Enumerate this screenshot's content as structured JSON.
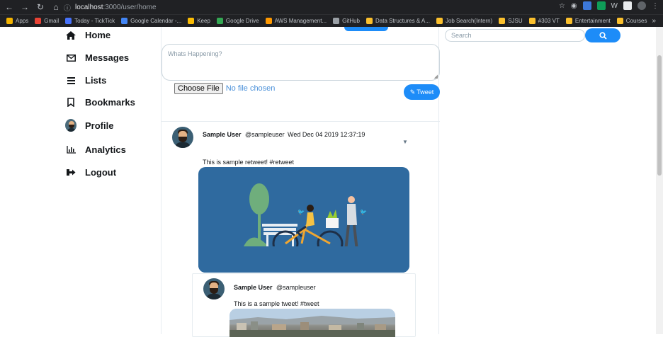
{
  "browser": {
    "url_host": "localhost",
    "url_path": ":3000/user/home",
    "bookmarks": [
      {
        "label": "Apps",
        "color": "#f4b400"
      },
      {
        "label": "Gmail",
        "color": "#ea4335"
      },
      {
        "label": "Today - TickTick",
        "color": "#4772fa"
      },
      {
        "label": "Google Calendar -...",
        "color": "#4285f4"
      },
      {
        "label": "Keep",
        "color": "#fbbc04"
      },
      {
        "label": "Google Drive",
        "color": "#34a853"
      },
      {
        "label": "AWS Management...",
        "color": "#ff9900"
      },
      {
        "label": "GitHub",
        "color": "#9aa0a6"
      },
      {
        "label": "Data Structures & A...",
        "color": "#fbc02d"
      },
      {
        "label": "Job Search(Intern)",
        "color": "#fbc02d"
      },
      {
        "label": "SJSU",
        "color": "#fbc02d"
      },
      {
        "label": "#303 VT",
        "color": "#fbc02d"
      },
      {
        "label": "Entertainment",
        "color": "#fbc02d"
      },
      {
        "label": "Courses",
        "color": "#fbc02d"
      }
    ],
    "more": "»"
  },
  "sidebar": {
    "items": [
      {
        "label": "Home",
        "icon": "home-icon"
      },
      {
        "label": "Messages",
        "icon": "envelope-icon"
      },
      {
        "label": "Lists",
        "icon": "list-icon"
      },
      {
        "label": "Bookmarks",
        "icon": "bookmark-icon"
      },
      {
        "label": "Profile",
        "icon": "avatar"
      },
      {
        "label": "Analytics",
        "icon": "chart-icon"
      },
      {
        "label": "Logout",
        "icon": "logout-icon"
      }
    ]
  },
  "compose": {
    "placeholder": "Whats Happening?",
    "file_button": "Choose File",
    "file_status": "No file chosen",
    "tweet_button": "Tweet"
  },
  "tweet": {
    "name": "Sample User",
    "handle": "@sampleuser",
    "date": "Wed Dec 04 2019 12:37:19",
    "text": "This is sample retweet! #retweet"
  },
  "quoted": {
    "name": "Sample User",
    "handle": "@sampleuser",
    "text": "This is a sample tweet! #tweet"
  },
  "search": {
    "placeholder": "Search"
  },
  "colors": {
    "accent": "#1d8cf8",
    "media_bg": "#2f6a9f"
  }
}
